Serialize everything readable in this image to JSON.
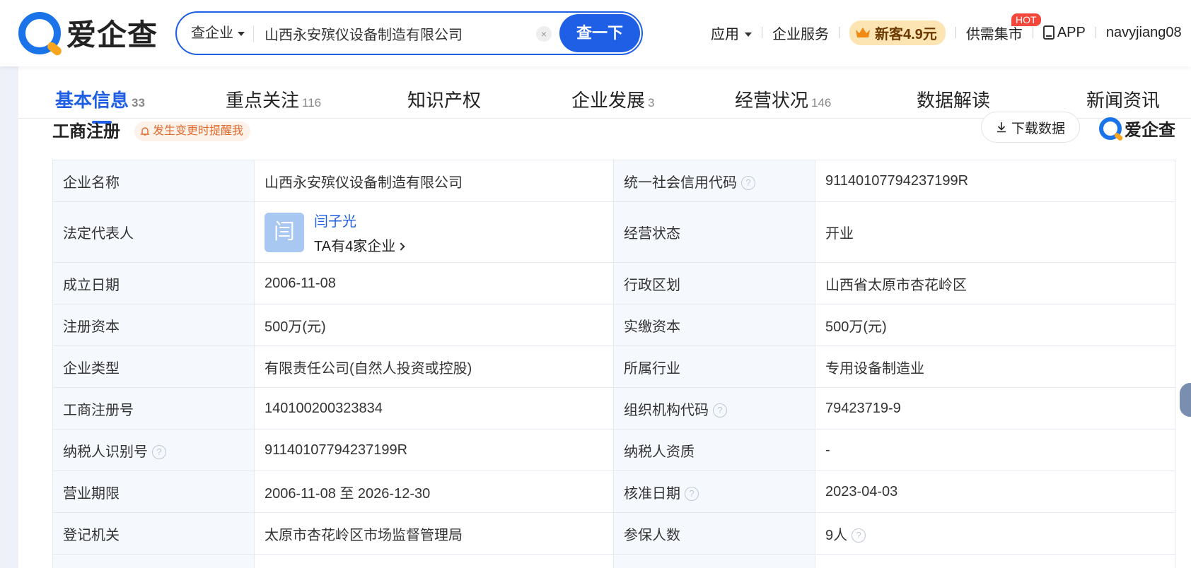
{
  "brand": {
    "name": "爱企查"
  },
  "search": {
    "type_label": "查企业",
    "query": "山西永安殡仪设备制造有限公司",
    "clear_icon": "×",
    "submit_label": "查一下"
  },
  "topnav": {
    "apps": "应用",
    "services": "企业服务",
    "promo": "新客4.9元",
    "market": "供需集市",
    "hot_badge": "HOT",
    "app": "APP",
    "user": "navyjiang08"
  },
  "tabs": [
    {
      "label": "基本信息",
      "count": "33"
    },
    {
      "label": "重点关注",
      "count": "116"
    },
    {
      "label": "知识产权",
      "count": ""
    },
    {
      "label": "企业发展",
      "count": "3"
    },
    {
      "label": "经营状况",
      "count": "146"
    },
    {
      "label": "数据解读",
      "count": ""
    },
    {
      "label": "新闻资讯",
      "count": ""
    }
  ],
  "section": {
    "title": "工商注册",
    "remind": "发生变更时提醒我",
    "download": "下载数据",
    "brand": "爱企查"
  },
  "info": {
    "rows": [
      {
        "l1": "企业名称",
        "v1": "山西永安殡仪设备制造有限公司",
        "l2": "统一社会信用代码",
        "v2": "91140107794237199R"
      },
      {
        "l1": "法定代表人",
        "v1_name": "闫子光",
        "v1_avatar": "闫",
        "v1_sub": "TA有4家企业",
        "l2": "经营状态",
        "v2": "开业"
      },
      {
        "l1": "成立日期",
        "v1": "2006-11-08",
        "l2": "行政区划",
        "v2": "山西省太原市杏花岭区"
      },
      {
        "l1": "注册资本",
        "v1": "500万(元)",
        "l2": "实缴资本",
        "v2": "500万(元)"
      },
      {
        "l1": "企业类型",
        "v1": "有限责任公司(自然人投资或控股)",
        "l2": "所属行业",
        "v2": "专用设备制造业"
      },
      {
        "l1": "工商注册号",
        "v1": "140100200323834",
        "l2": "组织机构代码",
        "v2": "79423719-9"
      },
      {
        "l1": "纳税人识别号",
        "v1": "91140107794237199R",
        "l2": "纳税人资质",
        "v2": "-"
      },
      {
        "l1": "营业期限",
        "v1": "2006-11-08 至 2026-12-30",
        "l2": "核准日期",
        "v2": "2023-04-03"
      },
      {
        "l1": "登记机关",
        "v1": "太原市杏花岭区市场监督管理局",
        "l2": "参保人数",
        "v2": "9人"
      }
    ],
    "help_glyph": "?"
  }
}
